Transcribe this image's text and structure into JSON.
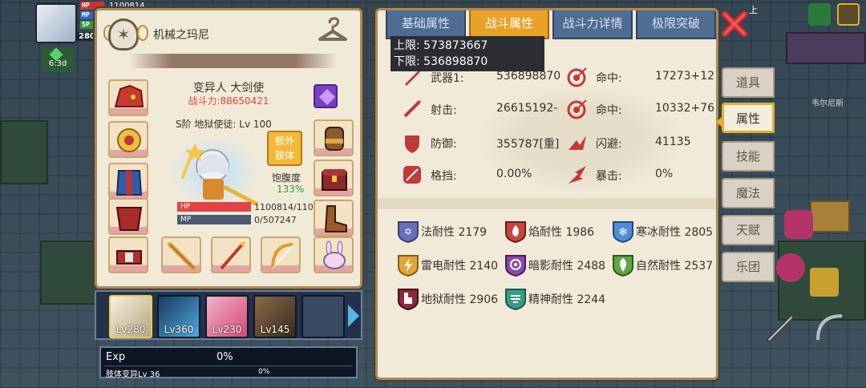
{
  "hud": {
    "hp_label": "HP",
    "mp_label": "MP",
    "sp_label": "SP",
    "hp_text": "1100814",
    "level_badge": "280",
    "timer": "6:3d",
    "city_name": "韦尔尼斯",
    "top_right_text": "上"
  },
  "character": {
    "name": "机械之玛尼",
    "class_title": "变异人 大剑使",
    "power_label": "战斗力:88650421",
    "rank_text": "S阶 地狱使徒: Lv 100",
    "extra_limb_button": "额外\n肢体",
    "satiety_label": "饱腹度",
    "satiety_value": "133%",
    "hp_bar_label": "HP",
    "mp_bar_label": "MP",
    "hp_value": "1100814/110",
    "mp_value": "0/507247",
    "hp_fraction": 1.0,
    "mp_fraction": 0.0
  },
  "companions": [
    {
      "level": "Lv280",
      "selected": true,
      "icon": "white-hair-hero"
    },
    {
      "level": "Lv360",
      "selected": false,
      "icon": "butterfly-wings"
    },
    {
      "level": "Lv230",
      "selected": false,
      "icon": "pink-hair-girl"
    },
    {
      "level": "Lv145",
      "selected": false,
      "icon": "brown-hat-hero"
    },
    {
      "level": "",
      "selected": false,
      "icon": "empty"
    }
  ],
  "exp": {
    "label": "Exp",
    "percent": "0%",
    "limb_label": "肢体变异Lv 36",
    "limb_percent": "0%"
  },
  "stats": {
    "tabs": [
      "基础属性",
      "战斗属性",
      "战斗力详情",
      "极限突破"
    ],
    "active_tab": 1,
    "upper_limit": "上限: 573873667",
    "lower_limit": "下限: 536898870",
    "rows": [
      {
        "left_label": "武器1:",
        "left_value": "536898870",
        "right_label": "命中:",
        "right_value": "17273+12"
      },
      {
        "left_label": "射击:",
        "left_value": "26615192-",
        "right_label": "命中:",
        "right_value": "10332+76"
      },
      {
        "left_label": "防御:",
        "left_value": "355787[重]",
        "right_label": "闪避:",
        "right_value": "41135"
      },
      {
        "left_label": "格挡:",
        "left_value": "0.00%",
        "right_label": "暴击:",
        "right_value": "0%"
      }
    ],
    "resistances": [
      {
        "text": "法耐性 2179",
        "color": "#6a6fb8",
        "icon": "magic-resist-icon"
      },
      {
        "text": "焰耐性 1986",
        "color": "#c9453e",
        "icon": "fire-resist-icon"
      },
      {
        "text": "寒冰耐性 2805",
        "color": "#4f8ed6",
        "icon": "ice-resist-icon"
      },
      {
        "text": "雷电耐性 2140",
        "color": "#e2a53a",
        "icon": "thunder-resist-icon"
      },
      {
        "text": "暗影耐性 2488",
        "color": "#8a4aa8",
        "icon": "shadow-resist-icon"
      },
      {
        "text": "自然耐性 2537",
        "color": "#5aa845",
        "icon": "nature-resist-icon"
      },
      {
        "text": "地狱耐性 2906",
        "color": "#8a2a3a",
        "icon": "hell-resist-icon"
      },
      {
        "text": "精神耐性 2244",
        "color": "#3a9a88",
        "icon": "spirit-resist-icon"
      }
    ]
  },
  "side_nav": {
    "items": [
      "道具",
      "属性",
      "技能",
      "魔法",
      "天赋",
      "乐团"
    ],
    "active": 1
  },
  "colors": {
    "panel_bg": "#f2ead8",
    "tab_active": "#e7a227",
    "tab_inactive": "#4f6c92",
    "power_red": "#e2423b",
    "satiety_green": "#2e9a3a"
  }
}
